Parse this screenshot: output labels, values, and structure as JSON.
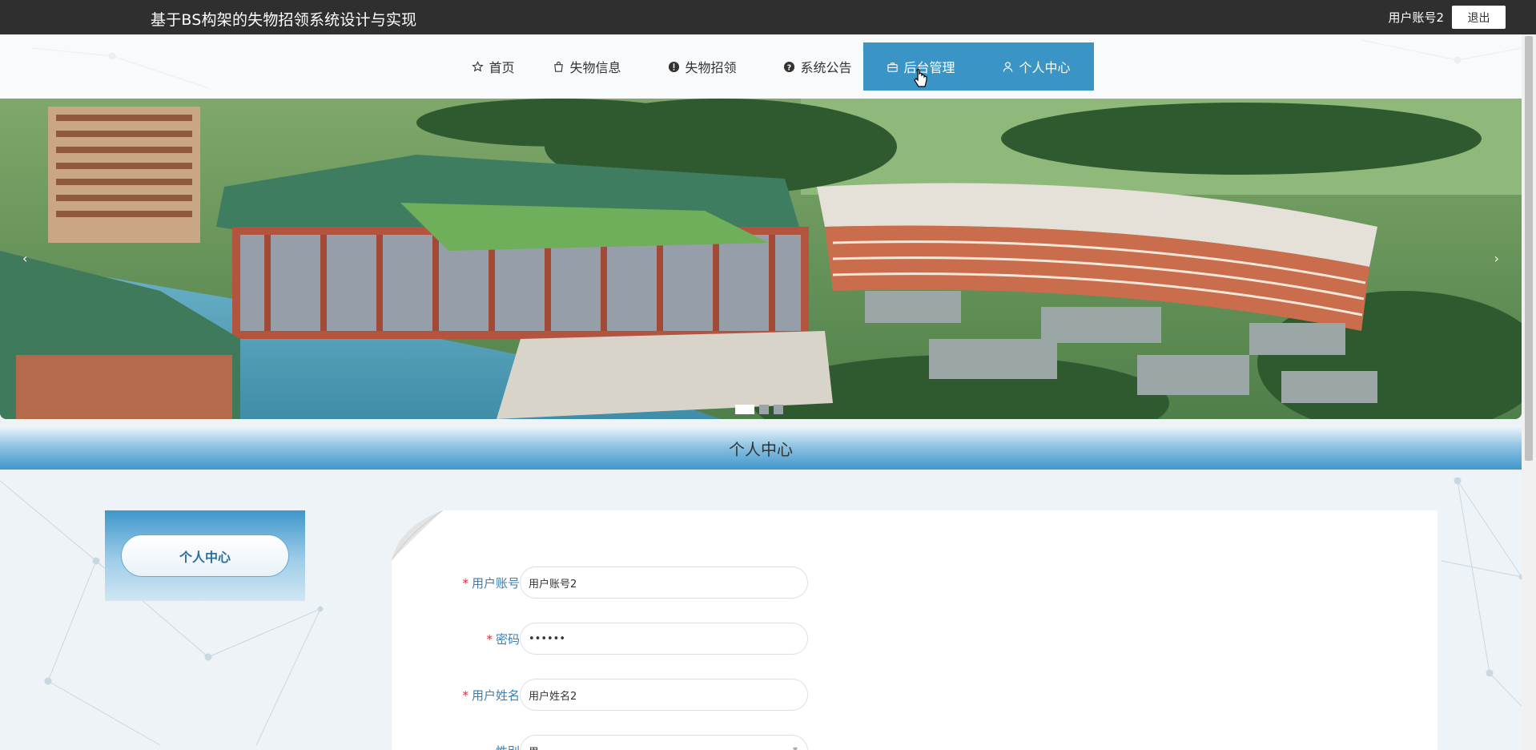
{
  "header": {
    "site_title": "基于BS构架的失物招领系统设计与实现",
    "user_name": "用户账号2",
    "logout_label": "退出"
  },
  "nav": {
    "items": [
      {
        "label": "首页",
        "icon": "star-icon"
      },
      {
        "label": "失物信息",
        "icon": "bag-icon"
      },
      {
        "label": "失物招领",
        "icon": "exclamation-icon"
      },
      {
        "label": "系统公告",
        "icon": "question-icon"
      },
      {
        "label": "后台管理",
        "icon": "briefcase-icon"
      },
      {
        "label": "个人中心",
        "icon": "user-icon"
      }
    ],
    "active_index": 4
  },
  "carousel": {
    "prev_arrow": "‹",
    "next_arrow": "›",
    "slide_count": 3,
    "active_slide": 1
  },
  "section": {
    "title": "个人中心"
  },
  "sidebar": {
    "button_label": "个人中心"
  },
  "form": {
    "fields": [
      {
        "label": "用户账号",
        "required": true,
        "value": "用户账号2"
      },
      {
        "label": "密码",
        "required": true,
        "value": "••••••"
      },
      {
        "label": "用户姓名",
        "required": true,
        "value": "用户姓名2"
      },
      {
        "label": "性别",
        "required": false,
        "value": "男"
      }
    ],
    "required_mark": "*"
  },
  "colors": {
    "topbar": "#2f2f2f",
    "accent": "#3b94c6",
    "label": "#3a7fb0"
  }
}
